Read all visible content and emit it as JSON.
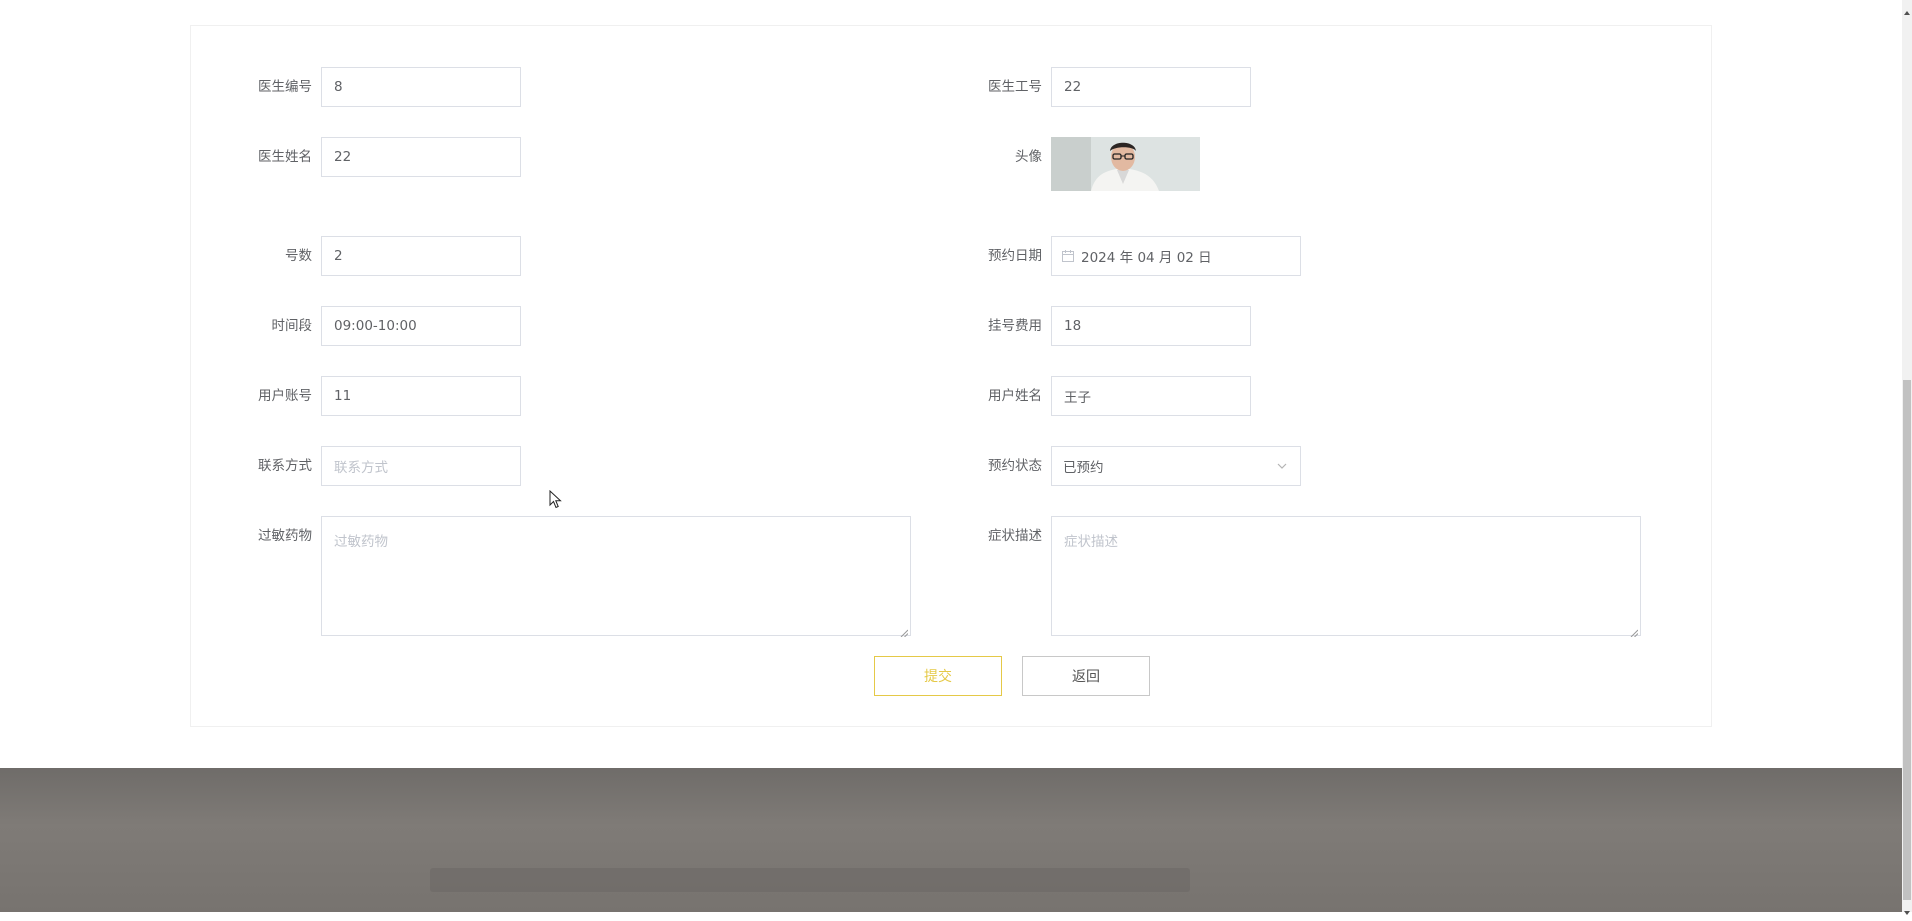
{
  "form": {
    "doctor_no": {
      "label": "医生编号",
      "value": "8"
    },
    "doctor_id": {
      "label": "医生工号",
      "value": "22"
    },
    "doctor_name": {
      "label": "医生姓名",
      "value": "22"
    },
    "avatar": {
      "label": "头像"
    },
    "number": {
      "label": "号数",
      "value": "2"
    },
    "appointment_date": {
      "label": "预约日期",
      "value": "2024 年 04 月 02 日"
    },
    "time_slot": {
      "label": "时间段",
      "value": "09:00-10:00"
    },
    "fee": {
      "label": "挂号费用",
      "value": "18"
    },
    "user_account": {
      "label": "用户账号",
      "value": "11"
    },
    "user_name": {
      "label": "用户姓名",
      "value": "王子"
    },
    "contact": {
      "label": "联系方式",
      "placeholder": "联系方式"
    },
    "status": {
      "label": "预约状态",
      "value": "已预约"
    },
    "allergy": {
      "label": "过敏药物",
      "placeholder": "过敏药物"
    },
    "symptoms": {
      "label": "症状描述",
      "placeholder": "症状描述"
    }
  },
  "buttons": {
    "submit": "提交",
    "back": "返回"
  },
  "colors": {
    "accent": "#e5c947",
    "border": "#dcdfe6",
    "placeholder": "#c0c4cc",
    "footer": "#77736f"
  },
  "icons": {
    "date": "calendar-icon",
    "select": "chevron-down-icon",
    "cursor": "mouse-pointer-icon"
  }
}
